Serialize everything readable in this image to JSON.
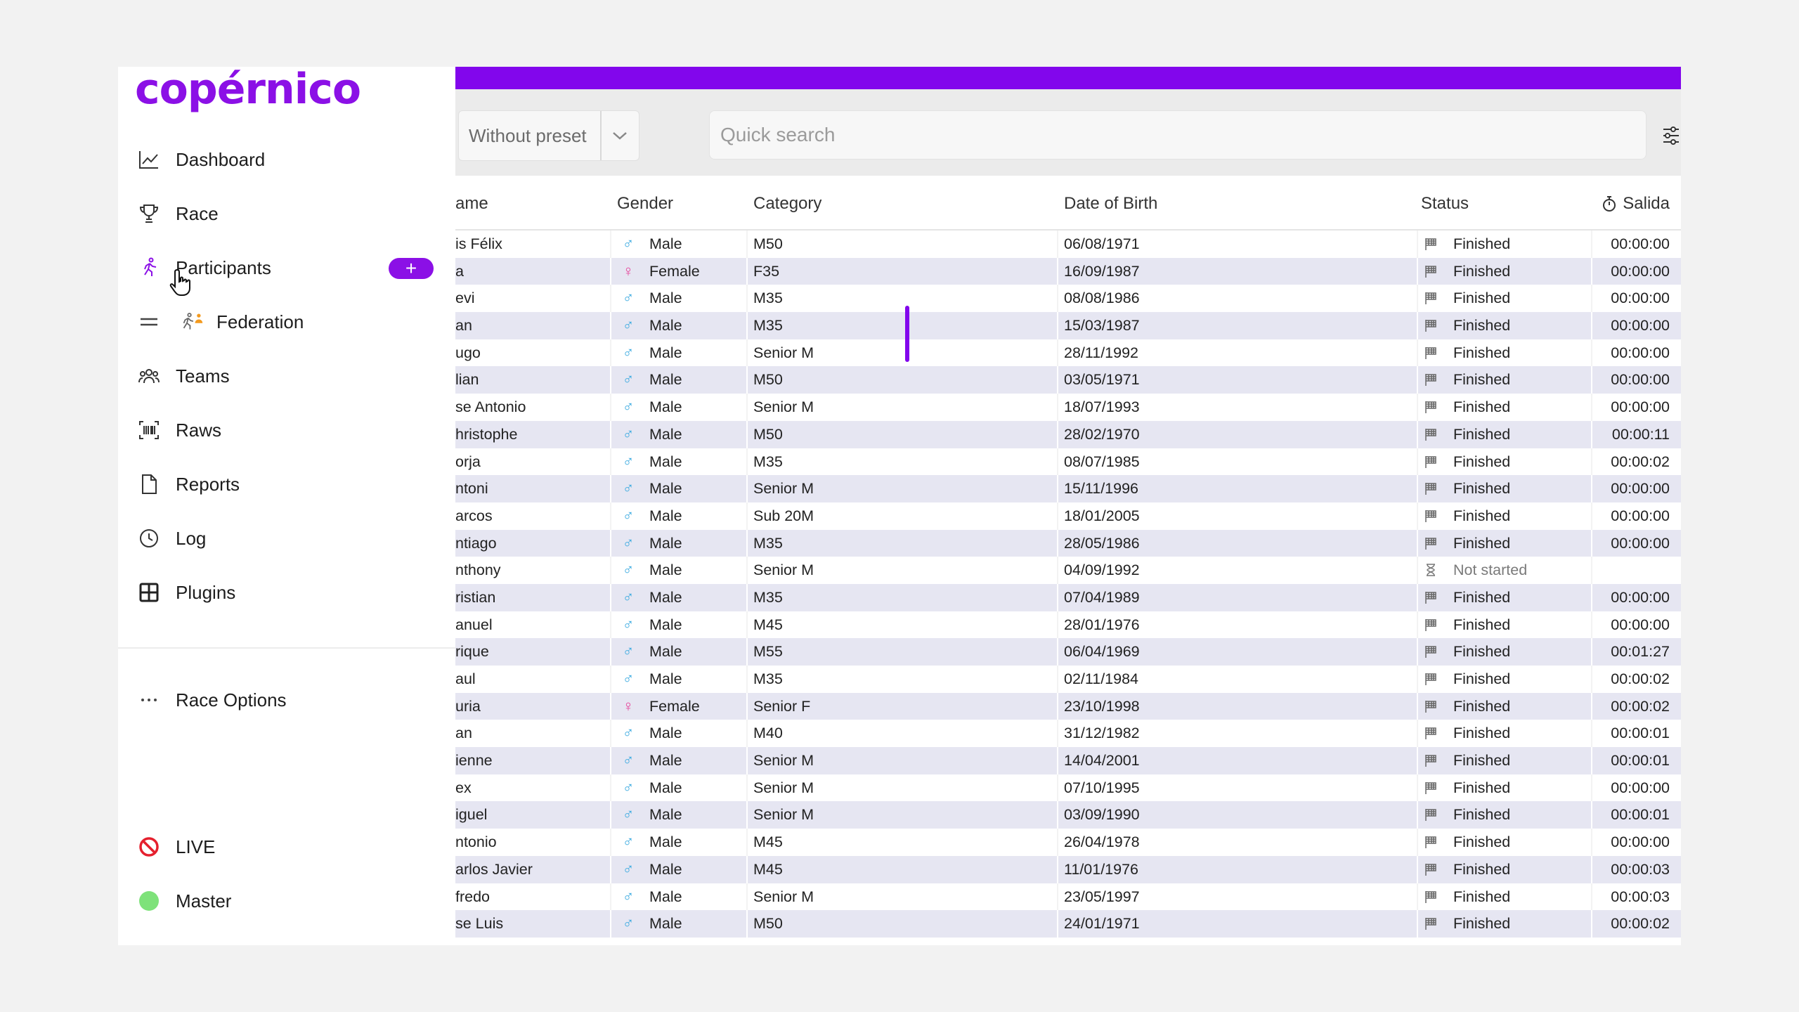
{
  "brand": {
    "logo_text": "copérnico",
    "accent": "#8b10e6"
  },
  "sidebar": {
    "items": [
      {
        "id": "dashboard",
        "label": "Dashboard",
        "icon": "chart-line-icon"
      },
      {
        "id": "race",
        "label": "Race",
        "icon": "trophy-icon"
      },
      {
        "id": "participants",
        "label": "Participants",
        "icon": "runner-icon",
        "active": true,
        "add_label": "+"
      },
      {
        "id": "federation",
        "label": "Federation",
        "icon": "federation-runner-icon"
      },
      {
        "id": "teams",
        "label": "Teams",
        "icon": "people-icon"
      },
      {
        "id": "raws",
        "label": "Raws",
        "icon": "barcode-icon"
      },
      {
        "id": "reports",
        "label": "Reports",
        "icon": "document-icon"
      },
      {
        "id": "log",
        "label": "Log",
        "icon": "clock-icon"
      },
      {
        "id": "plugins",
        "label": "Plugins",
        "icon": "grid-icon"
      }
    ],
    "race_options": {
      "label": "Race Options",
      "icon": "ellipsis-icon"
    },
    "live": {
      "label": "LIVE",
      "icon": "no-entry-icon",
      "color": "#e5202e"
    },
    "master": {
      "label": "Master",
      "status_color": "#7ee27a"
    }
  },
  "toolbar": {
    "preset": {
      "value": "Without preset"
    },
    "search": {
      "placeholder": "Quick search"
    }
  },
  "table": {
    "columns": {
      "name": "ame",
      "gender": "Gender",
      "category": "Category",
      "dob": "Date of Birth",
      "status": "Status",
      "salida": "Salida"
    },
    "rows": [
      {
        "name": "is Félix",
        "gender": "Male",
        "category": "M50",
        "dob": "06/08/1971",
        "status": "Finished",
        "time": "00:00:00"
      },
      {
        "name": "a",
        "gender": "Female",
        "category": "F35",
        "dob": "16/09/1987",
        "status": "Finished",
        "time": "00:00:00"
      },
      {
        "name": "evi",
        "gender": "Male",
        "category": "M35",
        "dob": "08/08/1986",
        "status": "Finished",
        "time": "00:00:00"
      },
      {
        "name": "an",
        "gender": "Male",
        "category": "M35",
        "dob": "15/03/1987",
        "status": "Finished",
        "time": "00:00:00"
      },
      {
        "name": "ugo",
        "gender": "Male",
        "category": "Senior M",
        "dob": "28/11/1992",
        "status": "Finished",
        "time": "00:00:00"
      },
      {
        "name": "lian",
        "gender": "Male",
        "category": "M50",
        "dob": "03/05/1971",
        "status": "Finished",
        "time": "00:00:00"
      },
      {
        "name": "se Antonio",
        "gender": "Male",
        "category": "Senior M",
        "dob": "18/07/1993",
        "status": "Finished",
        "time": "00:00:00"
      },
      {
        "name": "hristophe",
        "gender": "Male",
        "category": "M50",
        "dob": "28/02/1970",
        "status": "Finished",
        "time": "00:00:11"
      },
      {
        "name": "orja",
        "gender": "Male",
        "category": "M35",
        "dob": "08/07/1985",
        "status": "Finished",
        "time": "00:00:02"
      },
      {
        "name": "ntoni",
        "gender": "Male",
        "category": "Senior M",
        "dob": "15/11/1996",
        "status": "Finished",
        "time": "00:00:00"
      },
      {
        "name": "arcos",
        "gender": "Male",
        "category": "Sub 20M",
        "dob": "18/01/2005",
        "status": "Finished",
        "time": "00:00:00"
      },
      {
        "name": "ntiago",
        "gender": "Male",
        "category": "M35",
        "dob": "28/05/1986",
        "status": "Finished",
        "time": "00:00:00"
      },
      {
        "name": "nthony",
        "gender": "Male",
        "category": "Senior M",
        "dob": "04/09/1992",
        "status": "Not started",
        "time": ""
      },
      {
        "name": "ristian",
        "gender": "Male",
        "category": "M35",
        "dob": "07/04/1989",
        "status": "Finished",
        "time": "00:00:00"
      },
      {
        "name": "anuel",
        "gender": "Male",
        "category": "M45",
        "dob": "28/01/1976",
        "status": "Finished",
        "time": "00:00:00"
      },
      {
        "name": "rique",
        "gender": "Male",
        "category": "M55",
        "dob": "06/04/1969",
        "status": "Finished",
        "time": "00:01:27"
      },
      {
        "name": "aul",
        "gender": "Male",
        "category": "M35",
        "dob": "02/11/1984",
        "status": "Finished",
        "time": "00:00:02"
      },
      {
        "name": "uria",
        "gender": "Female",
        "category": "Senior F",
        "dob": "23/10/1998",
        "status": "Finished",
        "time": "00:00:02"
      },
      {
        "name": "an",
        "gender": "Male",
        "category": "M40",
        "dob": "31/12/1982",
        "status": "Finished",
        "time": "00:00:01"
      },
      {
        "name": "ienne",
        "gender": "Male",
        "category": "Senior M",
        "dob": "14/04/2001",
        "status": "Finished",
        "time": "00:00:01"
      },
      {
        "name": "ex",
        "gender": "Male",
        "category": "Senior M",
        "dob": "07/10/1995",
        "status": "Finished",
        "time": "00:00:00"
      },
      {
        "name": "iguel",
        "gender": "Male",
        "category": "Senior M",
        "dob": "03/09/1990",
        "status": "Finished",
        "time": "00:00:01"
      },
      {
        "name": "ntonio",
        "gender": "Male",
        "category": "M45",
        "dob": "26/04/1978",
        "status": "Finished",
        "time": "00:00:00"
      },
      {
        "name": "arlos Javier",
        "gender": "Male",
        "category": "M45",
        "dob": "11/01/1976",
        "status": "Finished",
        "time": "00:00:03"
      },
      {
        "name": "fredo",
        "gender": "Male",
        "category": "Senior M",
        "dob": "23/05/1997",
        "status": "Finished",
        "time": "00:00:03"
      },
      {
        "name": "se Luis",
        "gender": "Male",
        "category": "M50",
        "dob": "24/01/1971",
        "status": "Finished",
        "time": "00:00:02"
      }
    ]
  }
}
